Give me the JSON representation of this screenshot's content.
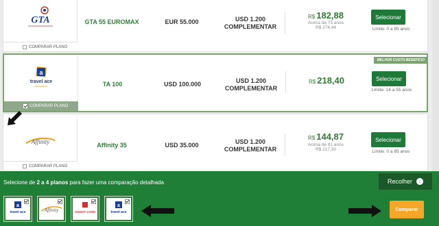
{
  "plans": [
    {
      "name": "GTA 55 EUROMAX",
      "coverage": "EUR 55.000",
      "extra_line1": "USD 1.200",
      "extra_line2": "COMPLEMENTAR",
      "currency": "R$",
      "price": "182,88",
      "price_note": "Acima de 75 anos",
      "price_old": "R$ 274,44",
      "button": "Selecionar",
      "limit": "Limite: 0 a 85 anos",
      "compare_label": "COMPARAR PLANO",
      "compare_checked": false
    },
    {
      "name": "TA 100",
      "coverage": "USD 100.000",
      "extra_line1": "USD 1.200",
      "extra_line2": "COMPLEMENTAR",
      "currency": "R$",
      "price": "218,40",
      "button": "Selecionar",
      "limit": "Limite: 14 a 55 anos",
      "compare_label": "COMPARAR PLANO",
      "compare_checked": true,
      "badge": "MELHOR CUSTO-BENEFÍCIO"
    },
    {
      "name": "Affinity 35",
      "coverage": "USD 35.000",
      "extra_line1": "USD 1.200",
      "extra_line2": "COMPLEMENTAR",
      "currency": "R$",
      "price": "144,87",
      "price_note": "Acima de 81 anos",
      "price_old": "R$ 217,30",
      "button": "Selecionar",
      "limit": "Limite: 0 a 85 anos",
      "compare_label": "COMPARAR PLANO",
      "compare_checked": false
    }
  ],
  "logos": {
    "gta": "GTA",
    "travel_ace": "travel ace",
    "travel_ace_sub": "assistance",
    "affinity": "Affinity",
    "assist_card": "ASSIST CARD"
  },
  "compare_bar": {
    "message_prefix": "Selecione de ",
    "message_bold": "2 a 4 planos",
    "message_suffix": " para fazer uma comparação detalhada",
    "collapse_label": "Recolher",
    "compare_button": "Comparar"
  },
  "colors": {
    "brand_green": "#1f7f36",
    "dark_green": "#1b5a28",
    "price_green": "#2e7d32",
    "highlight_border": "#7aa36f",
    "compare_orange": "#f6a72a"
  }
}
